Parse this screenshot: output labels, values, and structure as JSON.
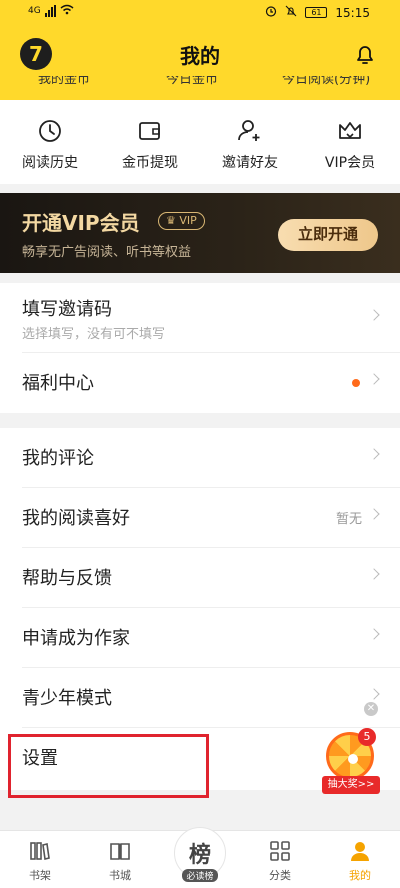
{
  "statusbar": {
    "time": "15:15",
    "battery": "61",
    "network": "4G"
  },
  "header": {
    "title": "我的",
    "logo_text": "7"
  },
  "stats": [
    "我的金币",
    "今日金币",
    "今日阅读(分钟)"
  ],
  "shortcuts": [
    {
      "label": "阅读历史",
      "icon": "clock-icon"
    },
    {
      "label": "金币提现",
      "icon": "wallet-icon"
    },
    {
      "label": "邀请好友",
      "icon": "add-user-icon"
    },
    {
      "label": "VIP会员",
      "icon": "crown-icon"
    }
  ],
  "vip": {
    "title": "开通VIP会员",
    "badge": "VIP",
    "subtitle": "畅享无广告阅读、听书等权益",
    "button": "立即开通"
  },
  "group1": {
    "invite": {
      "label": "填写邀请码",
      "hint": "选择填写，没有可不填写"
    },
    "welfare": {
      "label": "福利中心"
    }
  },
  "group2": {
    "comments": {
      "label": "我的评论"
    },
    "preference": {
      "label": "我的阅读喜好",
      "value": "暂无"
    },
    "help": {
      "label": "帮助与反馈"
    },
    "author": {
      "label": "申请成为作家"
    },
    "teen": {
      "label": "青少年模式"
    },
    "settings": {
      "label": "设置"
    }
  },
  "lottery": {
    "count": "5",
    "label": "抽大奖>>"
  },
  "nav": [
    {
      "label": "书架",
      "icon": "bookshelf-icon"
    },
    {
      "label": "书城",
      "icon": "book-icon"
    },
    {
      "label": "必读榜",
      "big": "榜",
      "icon": "ranking-icon"
    },
    {
      "label": "分类",
      "icon": "grid-icon"
    },
    {
      "label": "我的",
      "icon": "user-icon"
    }
  ],
  "colors": {
    "brand": "#ffd92b",
    "vip_gold": "#f3d8a2",
    "accent_red": "#e0232e",
    "dot": "#ff6a1a"
  }
}
